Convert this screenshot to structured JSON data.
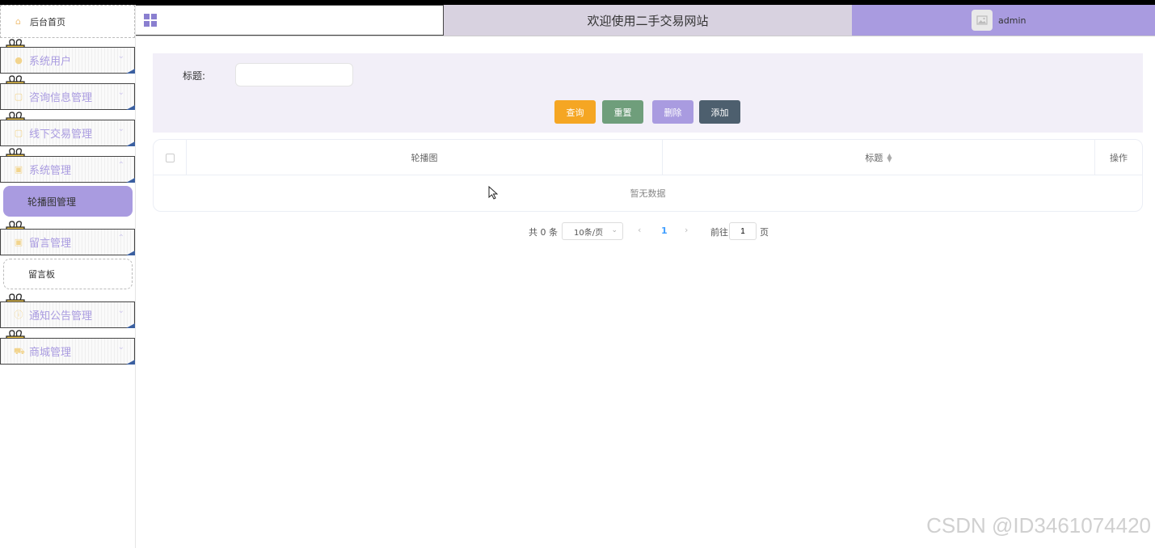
{
  "header": {
    "title": "欢迎使用二手交易网站",
    "username": "admin"
  },
  "sidebar": {
    "home_label": "后台首页",
    "items": [
      {
        "label": "系统用户",
        "icon": "user-icon"
      },
      {
        "label": "咨询信息管理",
        "icon": "document-icon"
      },
      {
        "label": "线下交易管理",
        "icon": "document-icon"
      },
      {
        "label": "系统管理",
        "icon": "picture-icon"
      },
      {
        "label": "留言管理",
        "icon": "picture-icon"
      },
      {
        "label": "通知公告管理",
        "icon": "info-icon"
      },
      {
        "label": "商城管理",
        "icon": "cart-icon"
      }
    ],
    "sub_active": "轮播图管理",
    "sub_plain": "留言板"
  },
  "search": {
    "label": "标题:",
    "value": "",
    "buttons": {
      "query": "查询",
      "reset": "重置",
      "delete": "删除",
      "add": "添加"
    }
  },
  "table": {
    "columns": [
      "轮播图",
      "标题",
      "操作"
    ],
    "empty_text": "暂无数据"
  },
  "pagination": {
    "total": "共 0 条",
    "page_size": "10条/页",
    "current_page": "1",
    "goto_label": "前往",
    "goto_value": "1",
    "page_label": "页"
  },
  "watermark": "CSDN @ID3461074420",
  "colors": {
    "accent": "#a99be0",
    "query": "#f5a623",
    "reset": "#6f9e7b",
    "add": "#4d5f6e",
    "title_bar": "#d8d2e0"
  }
}
